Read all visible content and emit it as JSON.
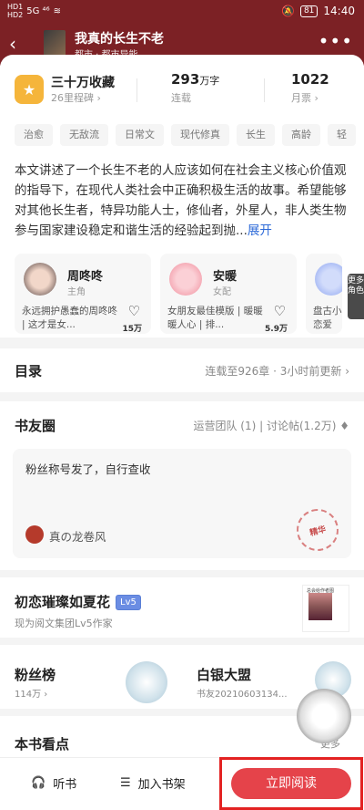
{
  "status": {
    "hd1": "HD1",
    "hd2": "HD2",
    "signal": "5G ⁴⁶",
    "battery": "81",
    "time": "14:40"
  },
  "header": {
    "back": "‹",
    "title": "我真的长生不老",
    "subtitle": "都市 · 都市异能",
    "more": "•••"
  },
  "stats": {
    "collect_title": "三十万收藏",
    "collect_sub": "26里程碑 ›",
    "words_num": "293",
    "words_unit": "万字",
    "words_sub": "连载",
    "tickets_num": "1022",
    "tickets_sub": "月票 ›"
  },
  "tags": [
    "治愈",
    "无敌流",
    "日常文",
    "现代修真",
    "长生",
    "高龄",
    "轻"
  ],
  "intro": {
    "text": "本文讲述了一个长生不老的人应该如何在社会主义核心价值观的指导下，在现代人类社会中正确积极生活的故事。希望能够对其他长生者，特异功能人士，修仙者，外星人，非人类生物参与国家建设稳定和谐生活的经验起到抛...",
    "expand": "展开"
  },
  "characters": [
    {
      "name": "周咚咚",
      "role": "主角",
      "desc": "永远拥护愚蠢的周咚咚 | 这才是女...",
      "likes": "15万"
    },
    {
      "name": "安暖",
      "role": "女配",
      "desc": "女朋友最佳模版 | 暖暖暖人心 | 排...",
      "likes": "5.9万"
    },
    {
      "name": "刘",
      "role": "",
      "desc": "盘古小裤 刘爷爷恋爱",
      "likes": ""
    }
  ],
  "more_roles": "更多角色",
  "toc": {
    "title": "目录",
    "info": "连载至926章 · 3小时前更新 ›"
  },
  "circle": {
    "title": "书友圈",
    "info": "运营团队 (1) | 讨论帖(1.2万) ♦",
    "post_text": "粉丝称号发了，自行查收",
    "post_author": "真の龙卷风",
    "stamp": "精华"
  },
  "author": {
    "name": "初恋璀璨如夏花",
    "level": "Lv5",
    "sub": "现为阅文集团Lv5作家",
    "poster_text": "总会给作者图"
  },
  "ranks": {
    "fans_title": "粉丝榜",
    "fans_sub": "114万 ›",
    "alliance_title": "白银大盟",
    "alliance_sub": "书友20210603134..."
  },
  "views": {
    "title": "本书看点",
    "more": "更多"
  },
  "bottom": {
    "listen": "听书",
    "shelf": "加入书架",
    "read": "立即阅读"
  },
  "colors": {
    "header": "#7c2125",
    "accent": "#e5434a",
    "highlight": "#e32222",
    "link": "#2d6ad8"
  }
}
